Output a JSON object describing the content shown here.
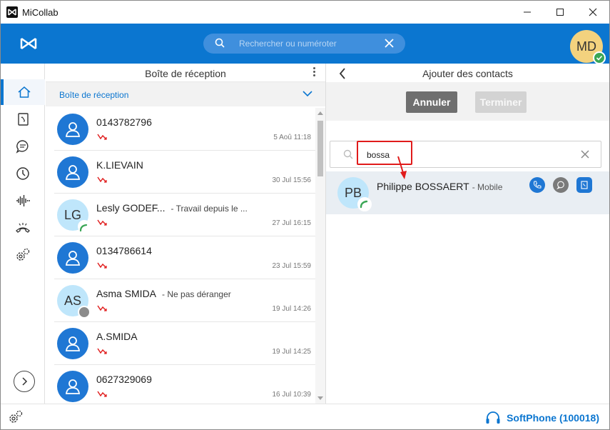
{
  "window": {
    "title": "MiCollab"
  },
  "topbar": {
    "search_placeholder": "Rechercher ou numéroter",
    "user_initials": "MD"
  },
  "inbox": {
    "title": "Boîte de réception",
    "filter_label": "Boîte de réception",
    "items": [
      {
        "name": "0143782796",
        "status_text": "",
        "timestamp": "5 Aoû 11:18",
        "avatar": "person",
        "initials": ""
      },
      {
        "name": "K.LIEVAIN",
        "status_text": "",
        "timestamp": "30 Jul 15:56",
        "avatar": "person",
        "initials": ""
      },
      {
        "name": "Lesly GODEF...",
        "status_text": "- Travail depuis le ...",
        "timestamp": "27 Jul 16:15",
        "avatar": "initials",
        "initials": "LG"
      },
      {
        "name": "0134786614",
        "status_text": "",
        "timestamp": "23 Jul 15:59",
        "avatar": "person",
        "initials": ""
      },
      {
        "name": "Asma SMIDA",
        "status_text": "- Ne pas déranger",
        "timestamp": "19 Jul 14:26",
        "avatar": "initials",
        "initials": "AS"
      },
      {
        "name": "A.SMIDA",
        "status_text": "",
        "timestamp": "19 Jul 14:25",
        "avatar": "person",
        "initials": ""
      },
      {
        "name": "0627329069",
        "status_text": "",
        "timestamp": "16 Jul 10:39",
        "avatar": "person",
        "initials": ""
      }
    ]
  },
  "add_contacts": {
    "title": "Ajouter des contacts",
    "cancel_label": "Annuler",
    "done_label": "Terminer",
    "search_value": "bossa",
    "result": {
      "initials": "PB",
      "name": "Philippe BOSSAERT",
      "type": "- Mobile"
    }
  },
  "bottombar": {
    "softphone_label": "SoftPhone (100018)"
  },
  "colors": {
    "accent": "#0b76d0",
    "missed": "#e01b1b",
    "highlight": "#e01b1b"
  }
}
